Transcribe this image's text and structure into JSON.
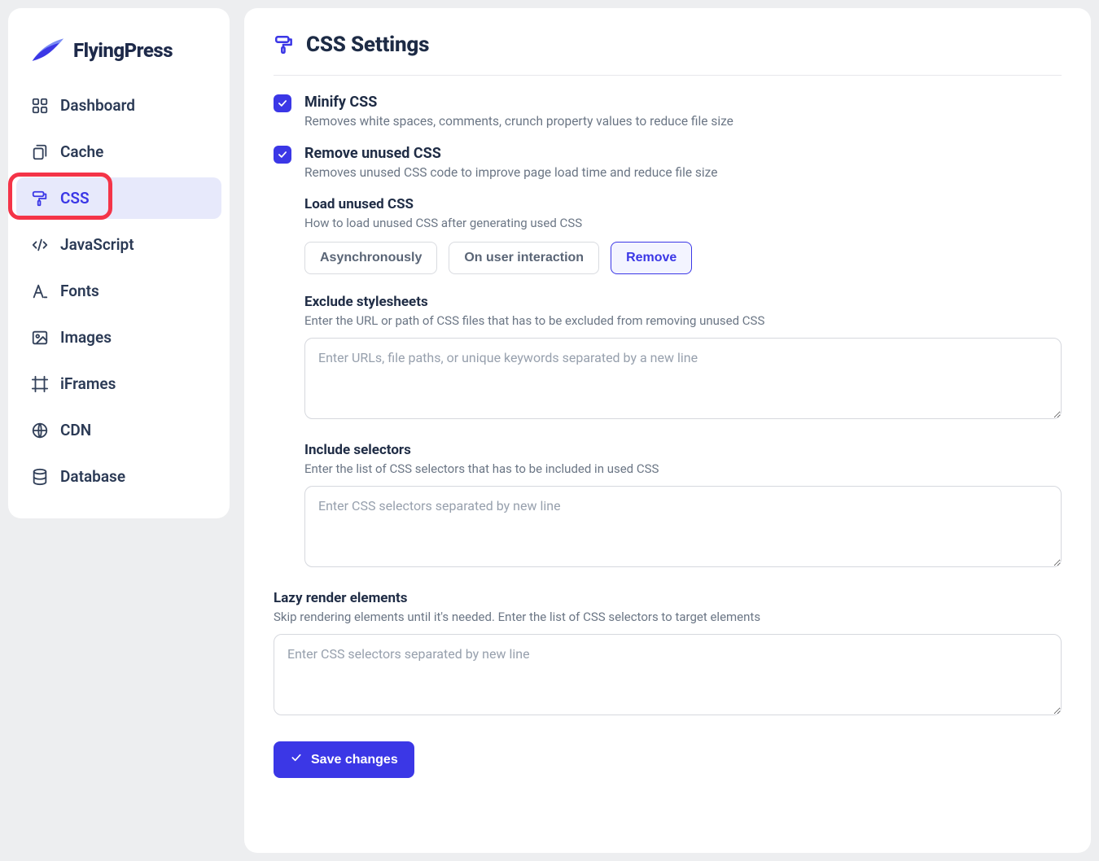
{
  "brand": {
    "name": "FlyingPress"
  },
  "sidebar": {
    "items": [
      {
        "label": "Dashboard"
      },
      {
        "label": "Cache"
      },
      {
        "label": "CSS"
      },
      {
        "label": "JavaScript"
      },
      {
        "label": "Fonts"
      },
      {
        "label": "Images"
      },
      {
        "label": "iFrames"
      },
      {
        "label": "CDN"
      },
      {
        "label": "Database"
      }
    ],
    "active_index": 2
  },
  "page": {
    "title": "CSS Settings"
  },
  "settings": {
    "minify": {
      "checked": true,
      "title": "Minify CSS",
      "desc": "Removes white spaces, comments, crunch property values to reduce file size"
    },
    "remove_unused": {
      "checked": true,
      "title": "Remove unused CSS",
      "desc": "Removes unused CSS code to improve page load time and reduce file size"
    },
    "load_unused": {
      "title": "Load unused CSS",
      "desc": "How to load unused CSS after generating used CSS",
      "options": [
        "Asynchronously",
        "On user interaction",
        "Remove"
      ],
      "selected_index": 2
    },
    "exclude_stylesheets": {
      "title": "Exclude stylesheets",
      "desc": "Enter the URL or path of CSS files that has to be excluded from removing unused CSS",
      "placeholder": "Enter URLs, file paths, or unique keywords separated by a new line",
      "value": ""
    },
    "include_selectors": {
      "title": "Include selectors",
      "desc": "Enter the list of CSS selectors that has to be included in used CSS",
      "placeholder": "Enter CSS selectors separated by new line",
      "value": ""
    },
    "lazy_render": {
      "title": "Lazy render elements",
      "desc": "Skip rendering elements until it's needed. Enter the list of CSS selectors to target elements",
      "placeholder": "Enter CSS selectors separated by new line",
      "value": ""
    }
  },
  "actions": {
    "save_label": "Save changes"
  },
  "colors": {
    "accent": "#3b37e6",
    "highlight": "#f43448",
    "text": "#1e293b",
    "muted": "#6b7685"
  }
}
